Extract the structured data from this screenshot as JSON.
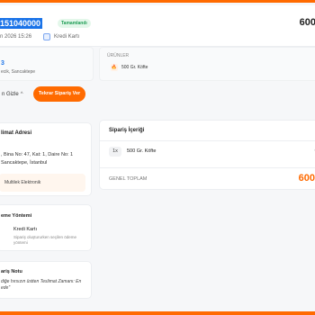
{
  "header": {
    "order_no": "151040000",
    "status": "Tamamlandı",
    "total": "600,",
    "date": "n 2026 15:26",
    "payment": "Kredi Kartı"
  },
  "summary": {
    "left_value": "3",
    "left_sub": "ecik, Sancaktepe",
    "right_label": "ÜRÜNLER",
    "item_icon": "fire-icon",
    "item": "500 Gr. Köfte"
  },
  "actions": {
    "hide_label": "n Gizle",
    "reorder_label": "Tekrar Sipariş Ver"
  },
  "address": {
    "title": "limat Adresi",
    "line1": ", Bina No: 47, Kat: 1, Daire No: 1",
    "line2": "Sancaktepe, İstanbul",
    "note": "Multilek Elektronik"
  },
  "payment_card": {
    "title": "eme Yöntemi",
    "method": "Kredi Kartı",
    "note": "Sipariş oluştururken seçilen ödeme yöntemi"
  },
  "order_note": {
    "title": "ariş Notu",
    "text": "diğe hırsızın üstten Teslimat Zamanı: En ede\""
  },
  "content": {
    "title": "Sipariş İçeriği",
    "items": [
      {
        "qty": "1x",
        "name": "500 Gr. Köfte",
        "price": "6"
      }
    ],
    "total_label": "GENEL TOPLAM",
    "total_value": "600,"
  },
  "colors": {
    "accent": "#ff6a00",
    "status_green": "#1f9d55",
    "selection_blue": "#1a73e8"
  }
}
